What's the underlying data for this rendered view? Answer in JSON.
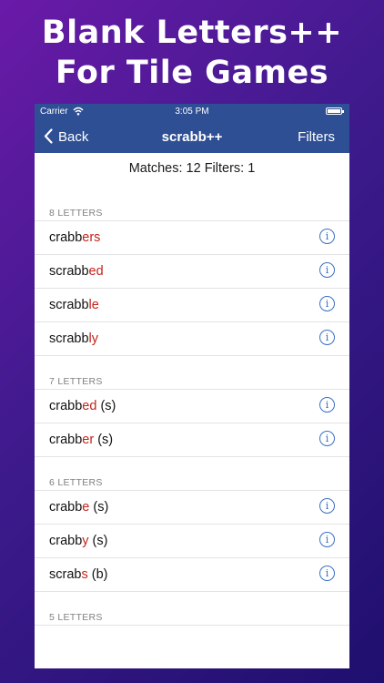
{
  "promo": {
    "line1": "Blank Letters++",
    "line2": "For Tile Games"
  },
  "status_bar": {
    "carrier": "Carrier",
    "time": "3:05 PM",
    "wifi_icon": "wifi-icon",
    "battery_icon": "battery-icon"
  },
  "nav": {
    "back_label": "Back",
    "title": "scrabb++",
    "filters_label": "Filters"
  },
  "summary": "Matches: 12 Filters: 1",
  "info_glyph": "i",
  "sections": [
    {
      "header": "8 LETTERS",
      "rows": [
        {
          "base": "crabb",
          "red": "ers",
          "suffix": ""
        },
        {
          "base": "scrabb",
          "red": "ed",
          "suffix": ""
        },
        {
          "base": "scrabb",
          "red": "le",
          "suffix": ""
        },
        {
          "base": "scrabb",
          "red": "ly",
          "suffix": ""
        }
      ]
    },
    {
      "header": "7 LETTERS",
      "rows": [
        {
          "base": "crabb",
          "red": "ed",
          "suffix": " (s)"
        },
        {
          "base": "crabb",
          "red": "er",
          "suffix": " (s)"
        }
      ]
    },
    {
      "header": "6 LETTERS",
      "rows": [
        {
          "base": "crabb",
          "red": "e",
          "suffix": " (s)"
        },
        {
          "base": "crabb",
          "red": "y",
          "suffix": " (s)"
        },
        {
          "base": "scrab",
          "red": "s",
          "suffix": " (b)"
        }
      ]
    },
    {
      "header": "5 LETTERS",
      "rows": []
    }
  ],
  "colors": {
    "nav_bar": "#2e4f94",
    "blank_letter_red": "#c4231b",
    "info_blue": "#3a6fc4"
  }
}
